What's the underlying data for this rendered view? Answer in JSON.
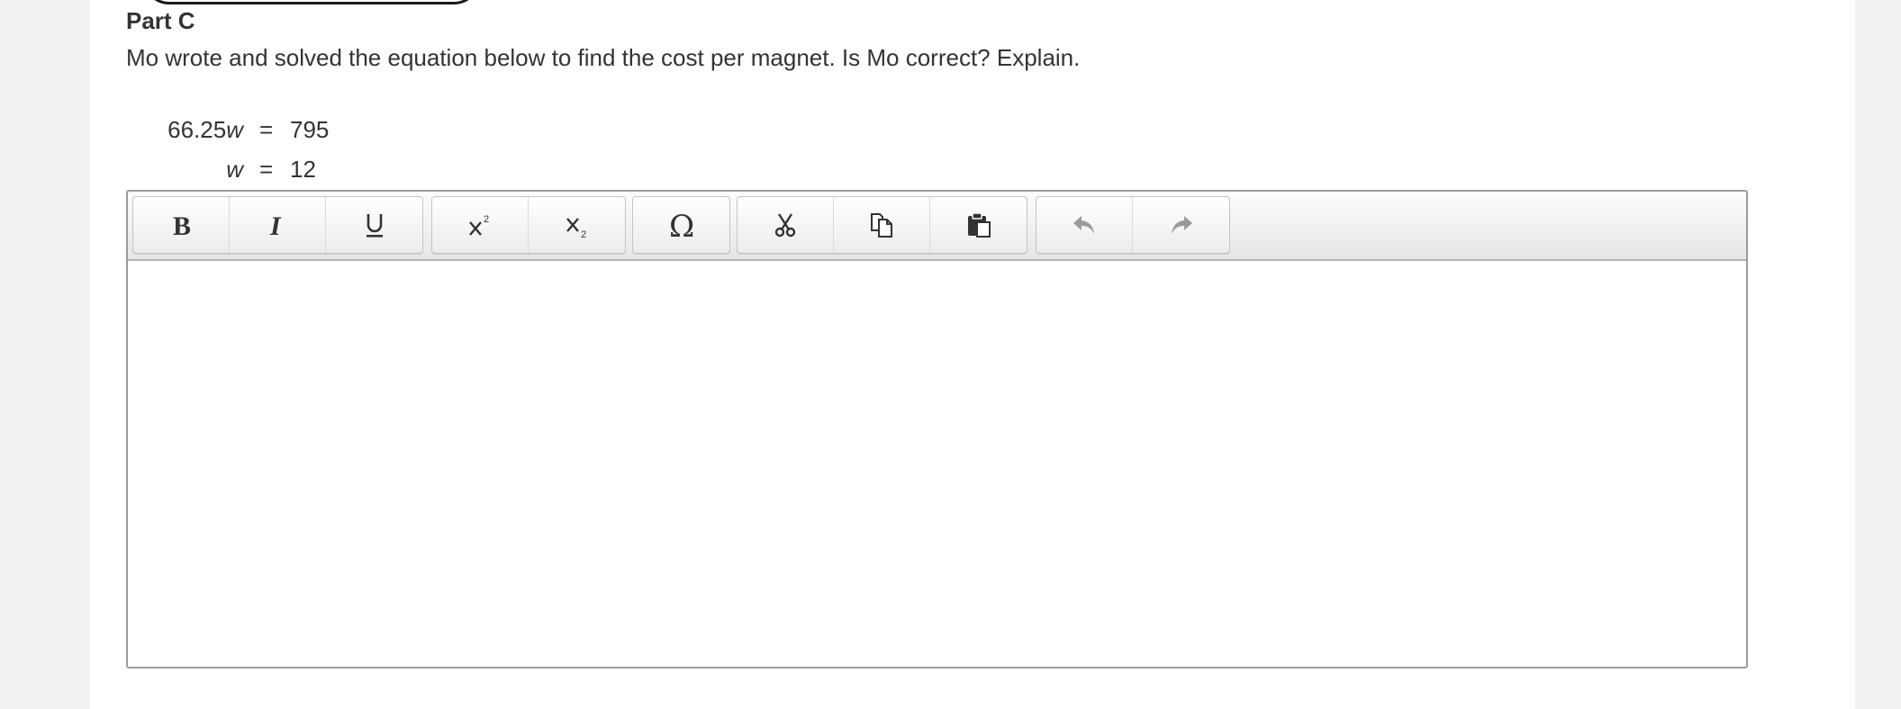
{
  "part": {
    "title": "Part C",
    "question": "Mo wrote and solved the equation below to find the cost per magnet. Is Mo correct? Explain."
  },
  "equation": {
    "line1": {
      "coef": "66.25",
      "var": "w",
      "op": "=",
      "rhs": "795"
    },
    "line2": {
      "coef": "",
      "var": "w",
      "op": "=",
      "rhs": "12"
    }
  },
  "toolbar": {
    "buttons": [
      {
        "name": "bold",
        "icon": "bold-icon"
      },
      {
        "name": "italic",
        "icon": "italic-icon"
      },
      {
        "name": "underline",
        "icon": "underline-icon"
      },
      {
        "name": "superscript",
        "icon": "superscript-icon"
      },
      {
        "name": "subscript",
        "icon": "subscript-icon"
      },
      {
        "name": "special-character",
        "icon": "omega-icon"
      },
      {
        "name": "cut",
        "icon": "scissors-icon"
      },
      {
        "name": "copy",
        "icon": "copy-icon"
      },
      {
        "name": "paste",
        "icon": "paste-icon"
      },
      {
        "name": "undo",
        "icon": "undo-icon"
      },
      {
        "name": "redo",
        "icon": "redo-icon"
      }
    ]
  },
  "editor": {
    "value": ""
  },
  "colors": {
    "text": "#333333",
    "border": "#9a9a9a",
    "disabled_icon": "#9a9a9a"
  }
}
